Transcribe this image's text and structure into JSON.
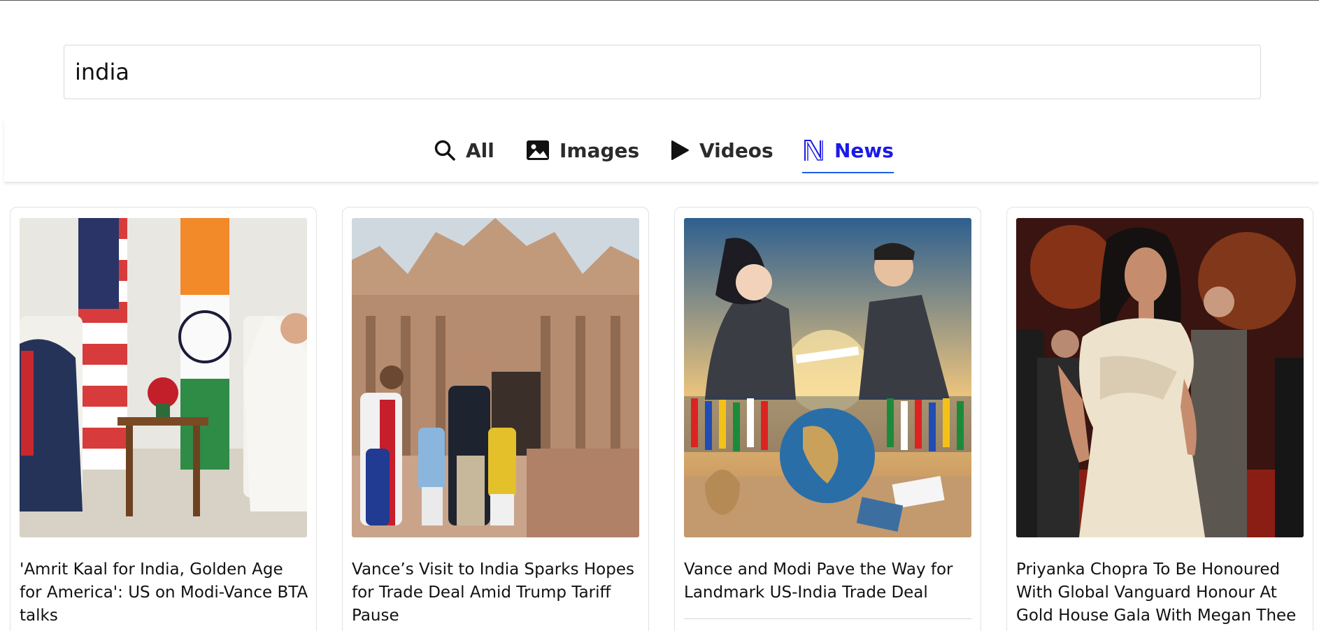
{
  "search": {
    "query": "india"
  },
  "tabs": [
    {
      "label": "All",
      "icon": "search-icon",
      "active": false
    },
    {
      "label": "Images",
      "icon": "image-icon",
      "active": false
    },
    {
      "label": "Videos",
      "icon": "play-icon",
      "active": false
    },
    {
      "label": "News",
      "icon": "news-logo-icon",
      "active": true
    }
  ],
  "colors": {
    "active_tab": "#1a1ae6",
    "active_underline": "#1f5ff0",
    "text": "#111111"
  },
  "articles": [
    {
      "title": "'Amrit Kaal for India, Golden Age for America': US on Modi-Vance BTA talks",
      "image": "meeting-with-flags-photo"
    },
    {
      "title": "Vance’s Visit to India Sparks Hopes for Trade Deal Amid Trump Tariff Pause",
      "image": "family-at-temple-photo"
    },
    {
      "title": "Vance and Modi Pave the Way for Landmark US-India Trade Deal",
      "image": "trade-deal-illustration"
    },
    {
      "title": "Priyanka Chopra To Be Honoured With Global Vanguard Honour At Gold House Gala With Megan Thee",
      "image": "celebrity-at-gala-photo"
    }
  ]
}
